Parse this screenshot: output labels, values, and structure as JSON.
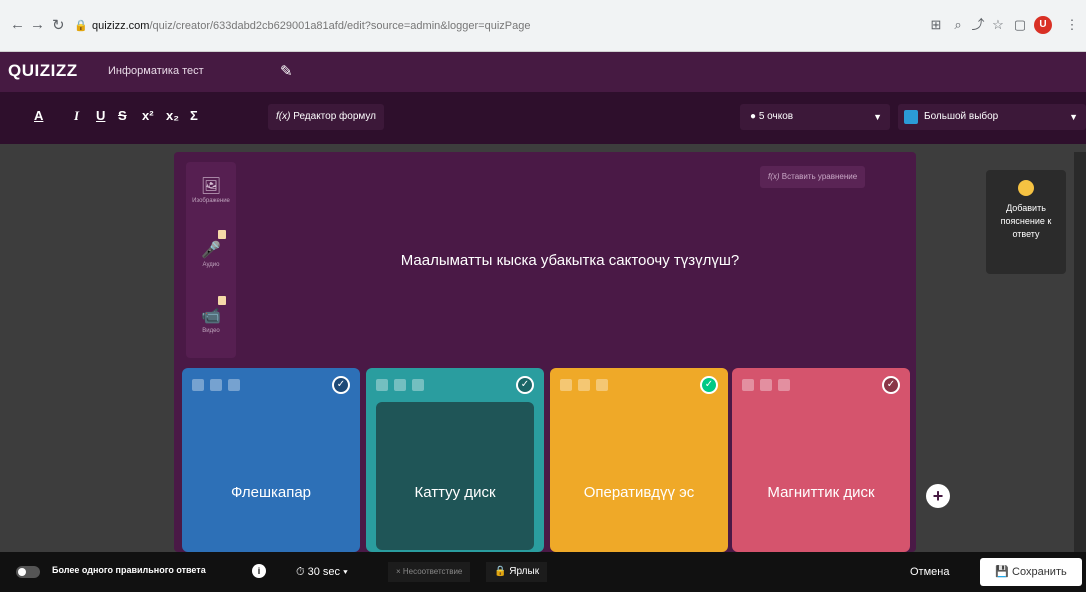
{
  "browser": {
    "back_icon": "arrow-left",
    "forward_icon": "arrow-right",
    "reload_icon": "reload",
    "url_host": "quizizz.com",
    "url_path": "/quiz/creator/633dabd2cb629001a81afd/edit?source=admin&logger=quizPage"
  },
  "app": {
    "logo": "QUIZIZZ",
    "quiz_title": "Информатика тест"
  },
  "toolbar": {
    "formula_label": "Редактор формул",
    "points_label": "5 очков",
    "question_type_label": "Большой выбор"
  },
  "editor": {
    "media": [
      {
        "icon": "image-icon",
        "label": "Изображение"
      },
      {
        "icon": "mic-icon",
        "label": "Аудио"
      },
      {
        "icon": "video-icon",
        "label": "Видео"
      }
    ],
    "insert_equation_label": "Вставить уравнение",
    "question": "Маалыматты кыска убакытка сактоочу түзүлүш?"
  },
  "answers": [
    {
      "label": "Флешкапар",
      "color": "#2d70b7",
      "correct": false
    },
    {
      "label": "Каттуу диск",
      "color": "#2a9d9f",
      "inner_color": "#1f5557",
      "correct": false
    },
    {
      "label": "Оперативдүү эс",
      "color": "#efa928",
      "correct": true
    },
    {
      "label": "Магниттик диск",
      "color": "#d5546d",
      "correct": false
    }
  ],
  "explanation": {
    "label": "Добавить пояснение к ответу"
  },
  "bottombar": {
    "multi_answer_label": "Более одного правильного ответа",
    "time_label": "30 sec",
    "irrelevant_label": "Несоответствие",
    "tag_label": "Ярлык",
    "cancel_label": "Отмена",
    "save_label": "Сохранить"
  },
  "colors": {
    "brand": "#461a42",
    "toolbar": "#2e0f2c",
    "correct": "#00c985"
  }
}
